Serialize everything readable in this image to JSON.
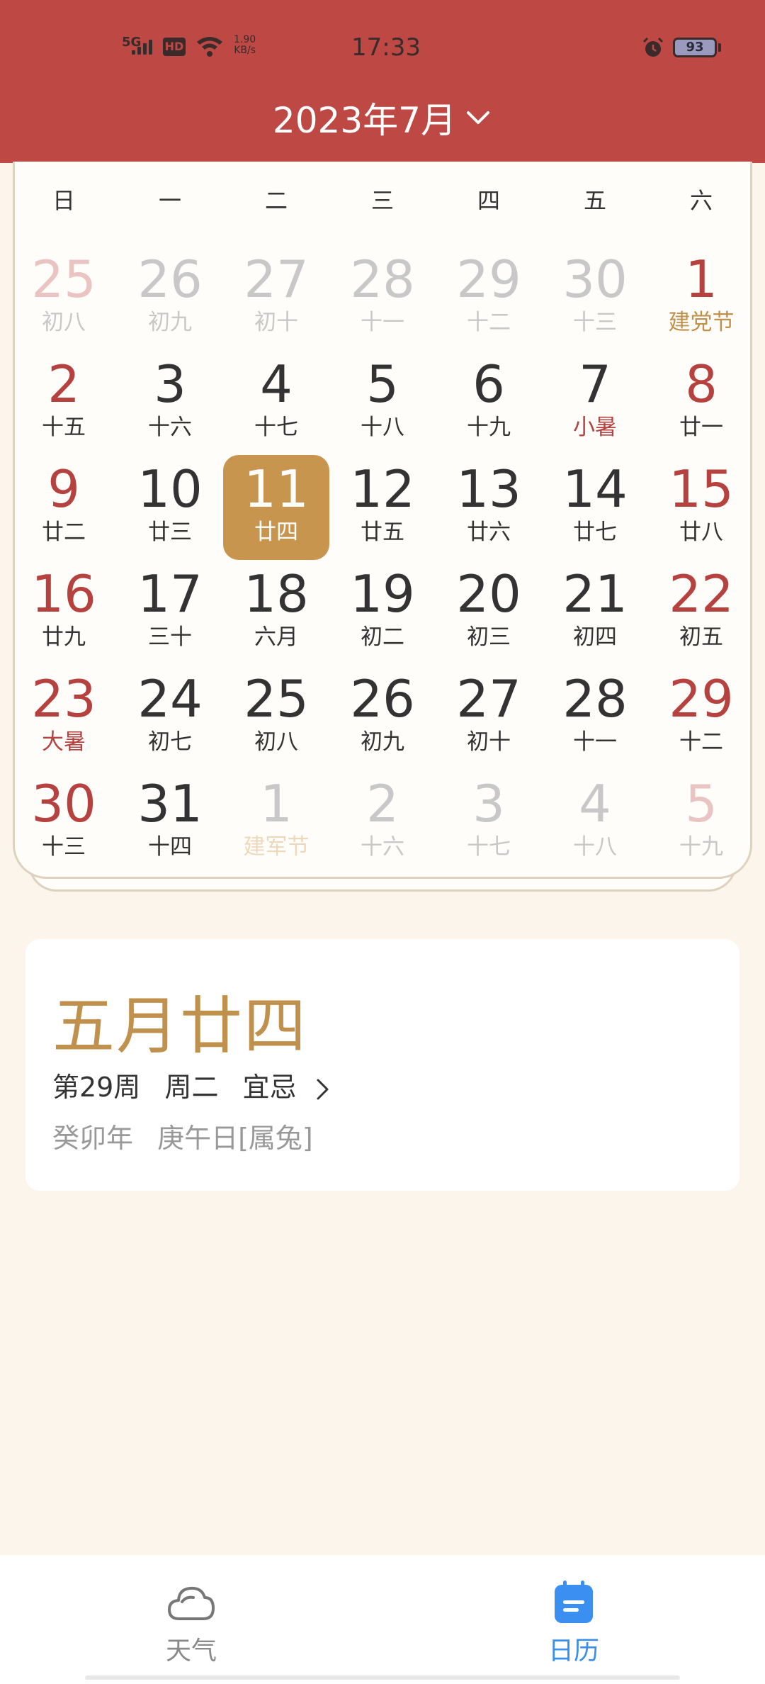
{
  "status_bar": {
    "network": "5G",
    "hd": "HD",
    "speed_value": "1.90",
    "speed_unit": "KB/s",
    "time": "17:33",
    "battery": "93"
  },
  "header": {
    "month_title": "2023年7月",
    "colors": {
      "header_bg": "#bd4844",
      "today_bg": "#c8954f",
      "weekend": "#b64240",
      "holiday": "#c0914c"
    }
  },
  "weekdays": [
    "日",
    "一",
    "二",
    "三",
    "四",
    "五",
    "六"
  ],
  "calendar": {
    "rows": [
      [
        {
          "day": "25",
          "lunar": "初八",
          "other": true
        },
        {
          "day": "26",
          "lunar": "初九",
          "other": true
        },
        {
          "day": "27",
          "lunar": "初十",
          "other": true
        },
        {
          "day": "28",
          "lunar": "十一",
          "other": true
        },
        {
          "day": "29",
          "lunar": "十二",
          "other": true
        },
        {
          "day": "30",
          "lunar": "十三",
          "other": true
        },
        {
          "day": "1",
          "lunar": "建党节",
          "holiday": true
        }
      ],
      [
        {
          "day": "2",
          "lunar": "十五"
        },
        {
          "day": "3",
          "lunar": "十六"
        },
        {
          "day": "4",
          "lunar": "十七"
        },
        {
          "day": "5",
          "lunar": "十八"
        },
        {
          "day": "6",
          "lunar": "十九"
        },
        {
          "day": "7",
          "lunar": "小暑",
          "term": true
        },
        {
          "day": "8",
          "lunar": "廿一"
        }
      ],
      [
        {
          "day": "9",
          "lunar": "廿二"
        },
        {
          "day": "10",
          "lunar": "廿三"
        },
        {
          "day": "11",
          "lunar": "廿四",
          "today": true
        },
        {
          "day": "12",
          "lunar": "廿五"
        },
        {
          "day": "13",
          "lunar": "廿六"
        },
        {
          "day": "14",
          "lunar": "廿七"
        },
        {
          "day": "15",
          "lunar": "廿八"
        }
      ],
      [
        {
          "day": "16",
          "lunar": "廿九"
        },
        {
          "day": "17",
          "lunar": "三十"
        },
        {
          "day": "18",
          "lunar": "六月"
        },
        {
          "day": "19",
          "lunar": "初二"
        },
        {
          "day": "20",
          "lunar": "初三"
        },
        {
          "day": "21",
          "lunar": "初四"
        },
        {
          "day": "22",
          "lunar": "初五"
        }
      ],
      [
        {
          "day": "23",
          "lunar": "大暑",
          "term": true
        },
        {
          "day": "24",
          "lunar": "初七"
        },
        {
          "day": "25",
          "lunar": "初八"
        },
        {
          "day": "26",
          "lunar": "初九"
        },
        {
          "day": "27",
          "lunar": "初十"
        },
        {
          "day": "28",
          "lunar": "十一"
        },
        {
          "day": "29",
          "lunar": "十二"
        }
      ],
      [
        {
          "day": "30",
          "lunar": "十三"
        },
        {
          "day": "31",
          "lunar": "十四"
        },
        {
          "day": "1",
          "lunar": "建军节",
          "other": true,
          "holiday": true
        },
        {
          "day": "2",
          "lunar": "十六",
          "other": true
        },
        {
          "day": "3",
          "lunar": "十七",
          "other": true
        },
        {
          "day": "4",
          "lunar": "十八",
          "other": true
        },
        {
          "day": "5",
          "lunar": "十九",
          "other": true
        }
      ]
    ]
  },
  "info": {
    "lunar_date": "五月廿四",
    "week": "第29周",
    "weekday": "周二",
    "yiji": "宜忌",
    "year_gz": "癸卯年",
    "day_gz": "庚午日[属兔]"
  },
  "nav": {
    "weather_label": "天气",
    "calendar_label": "日历",
    "weather_icon": "cloud-icon",
    "calendar_icon": "calendar-icon"
  }
}
